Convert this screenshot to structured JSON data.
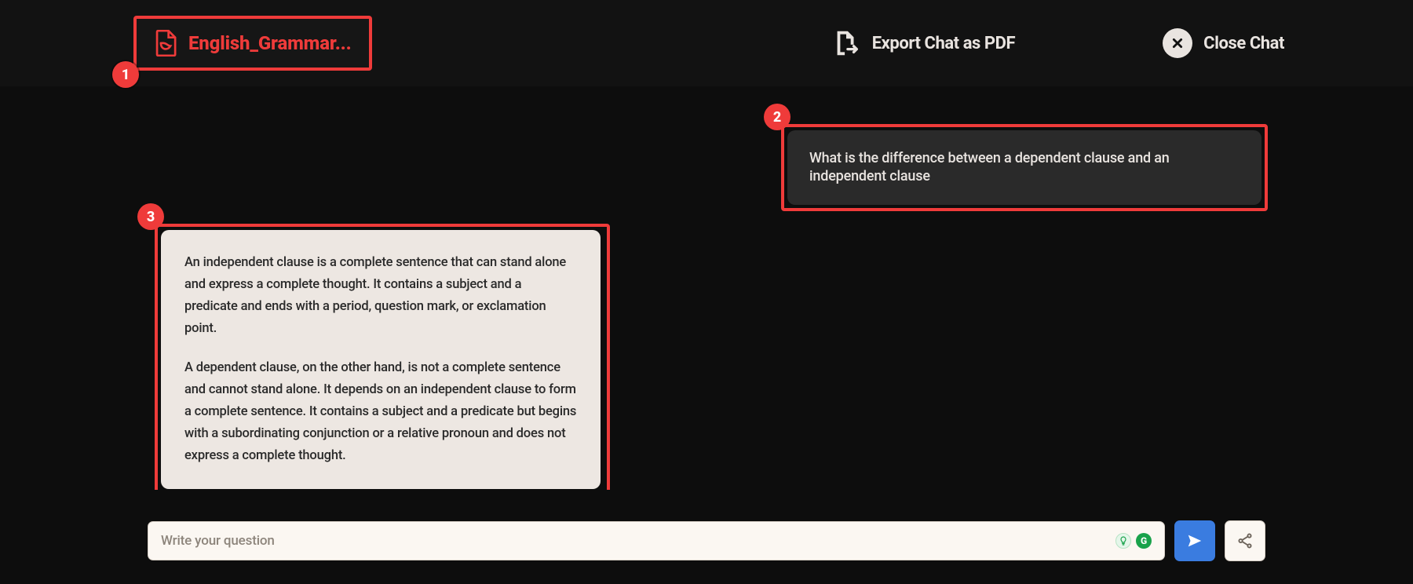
{
  "callouts": {
    "c1": "1",
    "c2": "2",
    "c3": "3"
  },
  "header": {
    "file_name": "English_Grammar...",
    "export_label": "Export Chat as PDF",
    "close_label": "Close Chat"
  },
  "chat": {
    "user_q": "What is the difference between a dependent clause and an independent clause",
    "bot_p1": "An independent clause is a complete sentence that can stand alone and express a complete thought. It contains a subject and a predicate and ends with a period, question mark, or exclamation point.",
    "bot_p2": "A dependent clause, on the other hand, is not a complete sentence and cannot stand alone. It depends on an independent clause to form a complete sentence. It contains a subject and a predicate but begins with a subordinating conjunction or a relative pronoun and does not express a complete thought."
  },
  "composer": {
    "placeholder": "Write your question",
    "grammarly_g": "G"
  }
}
